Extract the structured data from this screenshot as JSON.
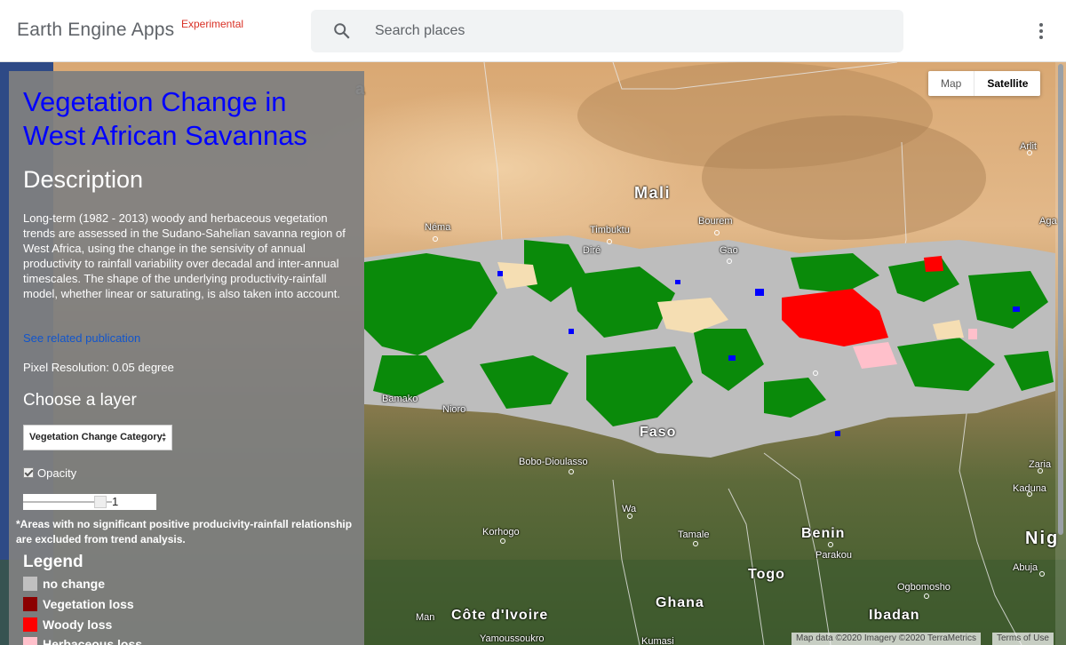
{
  "header": {
    "brand": "Earth Engine Apps",
    "brand_tag": "Experimental",
    "search_placeholder": "Search places"
  },
  "map": {
    "type_buttons": {
      "map": "Map",
      "satellite": "Satellite"
    },
    "active_type": "Satellite",
    "attribution": "Map data ©2020 Imagery ©2020 TerraMetrics",
    "terms": "Terms of Use",
    "labels": {
      "mali": "Mali",
      "benin": "Benin",
      "togo": "Togo",
      "ghana": "Ghana",
      "cote": "Côte d'Ivoire",
      "nig": "Nig",
      "nema": "Néma",
      "timbuktu": "Timbuktu",
      "bourem": "Bourem",
      "gao": "Gao",
      "dire": "Diré",
      "faso": "Faso",
      "bobo": "Bobo-Dioulasso",
      "korhogo": "Korhogo",
      "tamale": "Tamale",
      "wa": "Wa",
      "parakou": "Parakou",
      "ogbomosho": "Ogbomosho",
      "ibadan": "Ibadan",
      "abuja": "Abuja",
      "kaduna": "Kaduna",
      "zaria": "Zaria",
      "arlit": "Arlit",
      "aga": "Aga",
      "man": "Man",
      "yamoussoukro": "Yamoussoukro",
      "kumasi": "Kumasi",
      "bamako": "Bamako",
      "nioro": "Nioro",
      "a": "a"
    }
  },
  "panel": {
    "title": "Vegetation Change in West African Savannas",
    "description_heading": "Description",
    "description": "Long-term (1982 - 2013) woody and herbaceous vegetation trends are assessed in the Sudano-Sahelian savanna region of West Africa, using the change in the sensivity of annual productivity to rainfall variability over decadal and inter-annual timescales. The shape of the underlying productivity-rainfall model, whether linear or saturating, is also taken into account.",
    "publication_link": "See related publication",
    "resolution": "Pixel Resolution: 0.05 degree",
    "choose_layer": "Choose a layer",
    "layer_selected": "Vegetation Change Category",
    "opacity_label": "Opacity",
    "opacity_checked": true,
    "opacity_value": "1",
    "note": "*Areas with no significant positive producivity-rainfall relationship are excluded from trend analysis.",
    "legend_title": "Legend",
    "legend": [
      {
        "label": "no change",
        "color": "#c0c0c0"
      },
      {
        "label": "Vegetation loss",
        "color": "#8b0000"
      },
      {
        "label": "Woody loss",
        "color": "#ff0000"
      },
      {
        "label": "Herbaceous loss",
        "color": "#ffc0cb"
      }
    ]
  },
  "colors": {
    "title": "#0000ff",
    "link": "#1155cc",
    "panel_bg": "#808080",
    "green": "#008000",
    "blue": "#0000ff",
    "tan": "#f5deb3"
  }
}
